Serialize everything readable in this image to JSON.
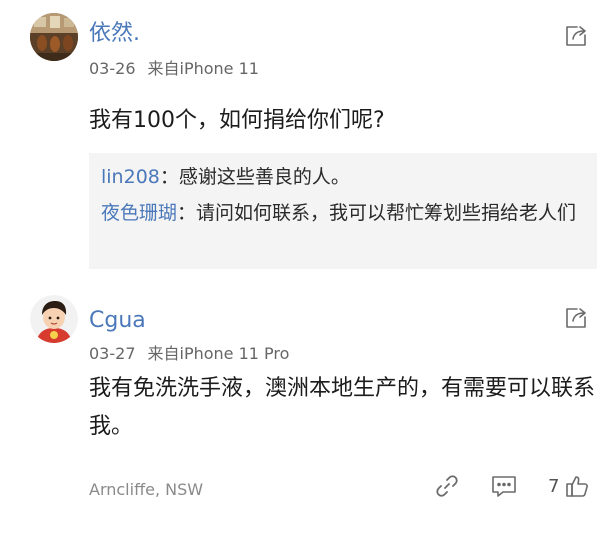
{
  "comments": [
    {
      "username": "依然.",
      "date": "03-26",
      "device": "来自iPhone 11",
      "avatar_icon": "violin-room-photo-avatar",
      "text": "我有100个，如何捐给你们呢?",
      "replies": [
        {
          "name": "lin208",
          "text": "：感谢这些善良的人。"
        },
        {
          "name": "夜色珊瑚",
          "text": "：请问如何联系，我可以帮忙筹划些捐给老人们"
        }
      ]
    },
    {
      "username": "Cgua",
      "date": "03-27",
      "device": "来自iPhone 11 Pro",
      "avatar_icon": "cartoon-boy-red-shirt-avatar",
      "text": "我有免洗洗手液，澳洲本地生产的，有需要可以联系我。",
      "location": "Arncliffe, NSW",
      "like_count": "7"
    }
  ],
  "colors": {
    "accent": "#4a78ba",
    "meta": "#666666",
    "reply_bg": "#f4f4f4",
    "icon": "#6b6b6b"
  }
}
